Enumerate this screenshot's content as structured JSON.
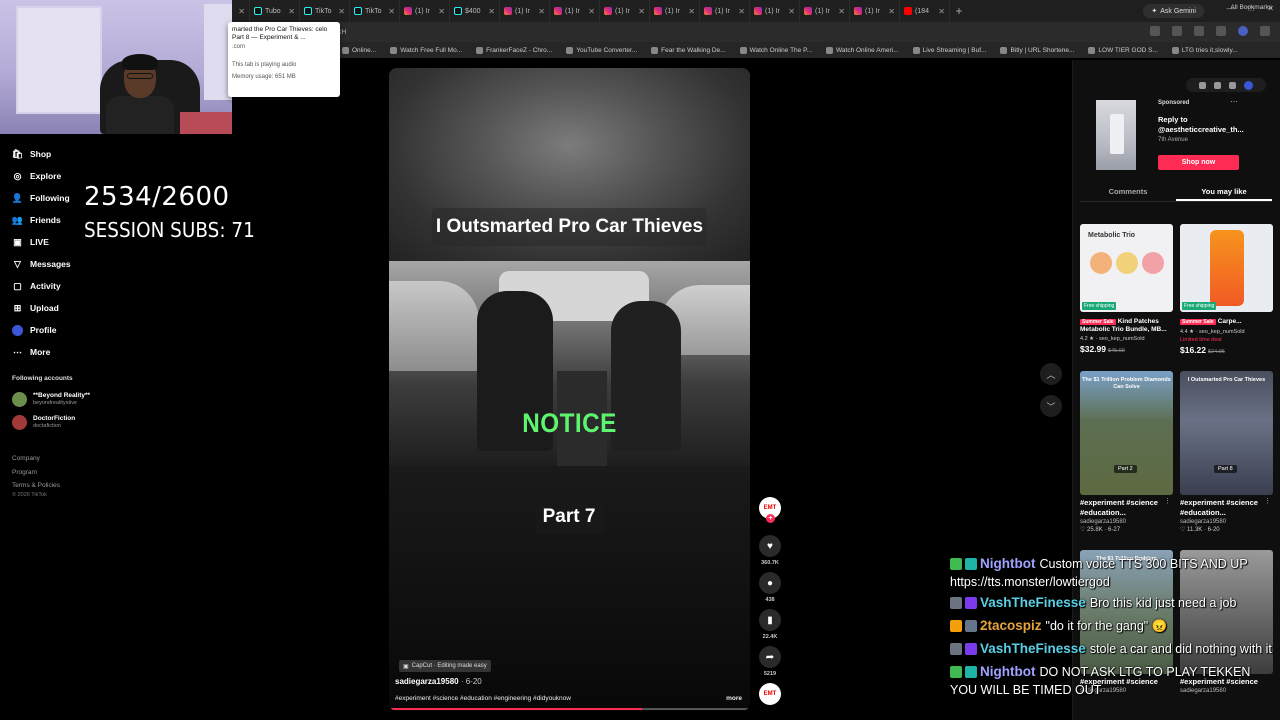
{
  "browser": {
    "tabs": [
      {
        "label": "C",
        "favicon": "tiktok",
        "active": true
      },
      {
        "label": "JoBla",
        "favicon": "generic"
      },
      {
        "label": "TikTo",
        "favicon": "tiktok"
      },
      {
        "label": "TikTo",
        "favicon": "tiktok"
      },
      {
        "label": "TikTo",
        "favicon": "tiktok"
      },
      {
        "label": "Tubo",
        "favicon": "tiktok"
      },
      {
        "label": "TikTo",
        "favicon": "tiktok"
      },
      {
        "label": "TikTo",
        "favicon": "tiktok"
      },
      {
        "label": "(1) Ir",
        "favicon": "instagram"
      },
      {
        "label": "$400",
        "favicon": "tiktok"
      },
      {
        "label": "(1) Ir",
        "favicon": "instagram"
      },
      {
        "label": "(1) Ir",
        "favicon": "instagram"
      },
      {
        "label": "(1) Ir",
        "favicon": "instagram"
      },
      {
        "label": "(1) Ir",
        "favicon": "instagram"
      },
      {
        "label": "(1) Ir",
        "favicon": "instagram"
      },
      {
        "label": "(1) Ir",
        "favicon": "instagram"
      },
      {
        "label": "(1) Ir",
        "favicon": "instagram"
      },
      {
        "label": "(1) Ir",
        "favicon": "instagram"
      },
      {
        "label": "(184",
        "favicon": "youtube"
      }
    ],
    "new_tab": "+",
    "ask_gemini": "Ask Gemini",
    "url_fragment": "gkH",
    "bookmarks": [
      "Online...",
      "Watch Free Full Mo...",
      "FrankerFaceZ - Chro...",
      "YouTube Converter...",
      "Fear the Walking De...",
      "Watch Online The P...",
      "Watch Online Ameri...",
      "Live Streaming | Buf...",
      "Bitly | URL Shortene...",
      "LOW TIER GOD S...",
      "LTG tries it,slowly..."
    ],
    "all_bookmarks": "All Bookmarks",
    "hover_card": {
      "title": "marted the Pro Car Thieves: celo Part 8 — Experiment & ...",
      "url": ".com",
      "audio": "This tab is playing audio",
      "memory": "Memory usage: 651 MB"
    }
  },
  "stream_overlay": {
    "sub_counter": "2534/2600",
    "session_subs": "SESSION SUBS: 71"
  },
  "sidebar": {
    "items": [
      {
        "label": "Shop",
        "icon": "shop-bag-icon"
      },
      {
        "label": "Explore",
        "icon": "compass-icon"
      },
      {
        "label": "Following",
        "icon": "following-icon"
      },
      {
        "label": "Friends",
        "icon": "friends-icon"
      },
      {
        "label": "LIVE",
        "icon": "live-icon"
      },
      {
        "label": "Messages",
        "icon": "messages-icon"
      },
      {
        "label": "Activity",
        "icon": "activity-icon"
      },
      {
        "label": "Upload",
        "icon": "upload-icon"
      },
      {
        "label": "Profile",
        "icon": "profile-avatar-icon"
      },
      {
        "label": "More",
        "icon": "more-dots-icon"
      }
    ],
    "following_header": "Following accounts",
    "following": [
      {
        "name": "**Beyond Reality**",
        "handle": "beyondrealitystive"
      },
      {
        "name": "DoctorFiction",
        "handle": "doctafiction"
      }
    ],
    "footer": [
      "Company",
      "Program",
      "Terms & Policies"
    ],
    "copyright": "© 2026 TikTok"
  },
  "video": {
    "title_overlay": "I Outsmarted Pro Car Thieves",
    "notice_overlay": "NOTICE",
    "part_overlay": "Part 7",
    "capcut": "CapCut · Editing made easy",
    "author": "sadiegarza19580",
    "date": "· 6-20",
    "tags": "#experiment #science #education #engineering #didyouknow",
    "more": "more",
    "progress": 0.7,
    "colors": {
      "notice": "#5ef56e",
      "progress": "#fe2c55"
    }
  },
  "actions": {
    "avatar_text": "EMT",
    "likes": "360.7K",
    "comments": "438",
    "saves": "22.4K",
    "shares": "5219"
  },
  "right_panel": {
    "sponsored": {
      "label": "Sponsored",
      "reply": "Reply to @aestheticcreative_th...",
      "sub": "7th Avenue",
      "button": "Shop now"
    },
    "tabs": [
      "Comments",
      "You may like"
    ],
    "products": [
      {
        "img_title": "Metabolic Trio",
        "badge": "Free shipping",
        "sale": "Summer Sale",
        "title": "Kind Patches Metabolic Trio Bundle, MB...",
        "rating": "4.2 ★ · seo_kep_numSold",
        "price": "$32.99",
        "old_price": "$45.00"
      },
      {
        "img_title": "",
        "badge": "Free shipping",
        "sale": "Summer Sale",
        "title": "Carpe...",
        "rating": "4.4 ★ · seo_kep_numSold",
        "flash": "Limited time deal",
        "price": "$16.22",
        "old_price": "$24.95"
      }
    ],
    "videos": [
      {
        "caption": "The $1 Trillion Problem Diamonds Can Solve",
        "part": "Part 2",
        "title": "#experiment #science #education...",
        "author": "sadiegarza19580",
        "meta": "♡ 25.8K · 6-27"
      },
      {
        "caption": "I Outsmarted Pro Car Thieves",
        "part": "Part 8",
        "title": "#experiment #science #education...",
        "author": "sadiegarza19580",
        "meta": "♡ 11.3K · 6-20"
      },
      {
        "caption": "The $1 Trillion Problem",
        "part": "",
        "title": "#experiment #science",
        "author": "sadiegarza19580",
        "meta": ""
      },
      {
        "caption": "",
        "part": "",
        "title": "#experiment #science",
        "author": "sadiegarza19580",
        "meta": ""
      }
    ]
  },
  "chat": [
    {
      "name": "Nightbot",
      "color": "#9fa3ff",
      "text": "Custom voice TTS 300 BITS AND UP https://tts.monster/lowtiergod"
    },
    {
      "name": "VashTheFinesse",
      "color": "#5ad0e6",
      "text": "Bro this kid just need a job"
    },
    {
      "name": "2tacospiz",
      "color": "#e8a33c",
      "text": "\"do it for the gang\" 😠"
    },
    {
      "name": "VashTheFinesse",
      "color": "#5ad0e6",
      "text": "stole a car and did nothing with it"
    },
    {
      "name": "Nightbot",
      "color": "#9fa3ff",
      "text": "DO NOT ASK LTG TO PLAY TEKKEN YOU WILL BE TIMED OUT"
    }
  ]
}
